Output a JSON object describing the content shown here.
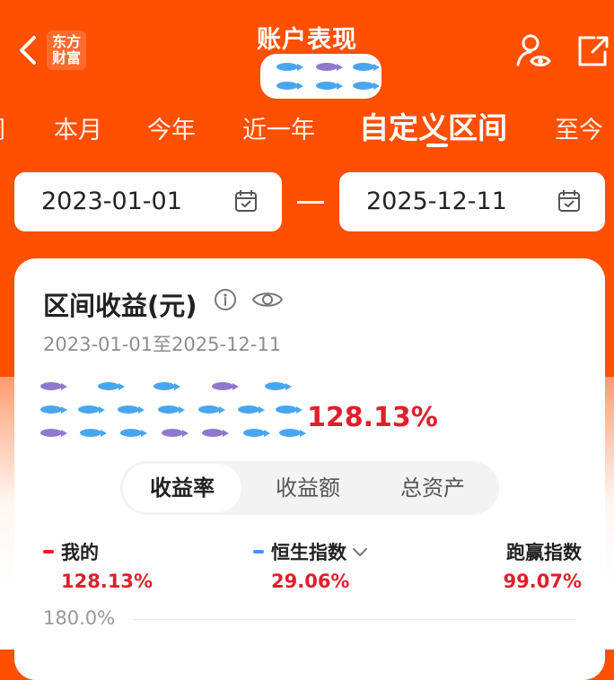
{
  "header": {
    "back_icon": "chevron-left-icon",
    "logo_text_line1": "东方",
    "logo_text_line2": "财富",
    "title": "账户表现",
    "user_eye_icon": "user-eye-icon",
    "share_icon": "external-link-icon"
  },
  "tabs": {
    "items": [
      "周",
      "本月",
      "今年",
      "近一年",
      "自定义区间",
      "至今"
    ],
    "active_index": 4
  },
  "date_range": {
    "start": "2023-01-01",
    "end": "2025-12-11"
  },
  "card": {
    "title": "区间收益(元)",
    "range_text": "2023-01-01至2025-12-11",
    "return_pct": "128.13%",
    "segments": [
      "收益率",
      "收益额",
      "总资产"
    ],
    "legend": {
      "mine_name": "我的",
      "mine_value": "128.13%",
      "hs_name": "恒生指数",
      "hs_value": "29.06%",
      "beat_name": "跑赢指数",
      "beat_value": "99.07%"
    },
    "axis_label": "180.0%"
  },
  "colors": {
    "brand": "#ff4f00",
    "red": "#e01f2c",
    "blue": "#4a8ef6"
  }
}
